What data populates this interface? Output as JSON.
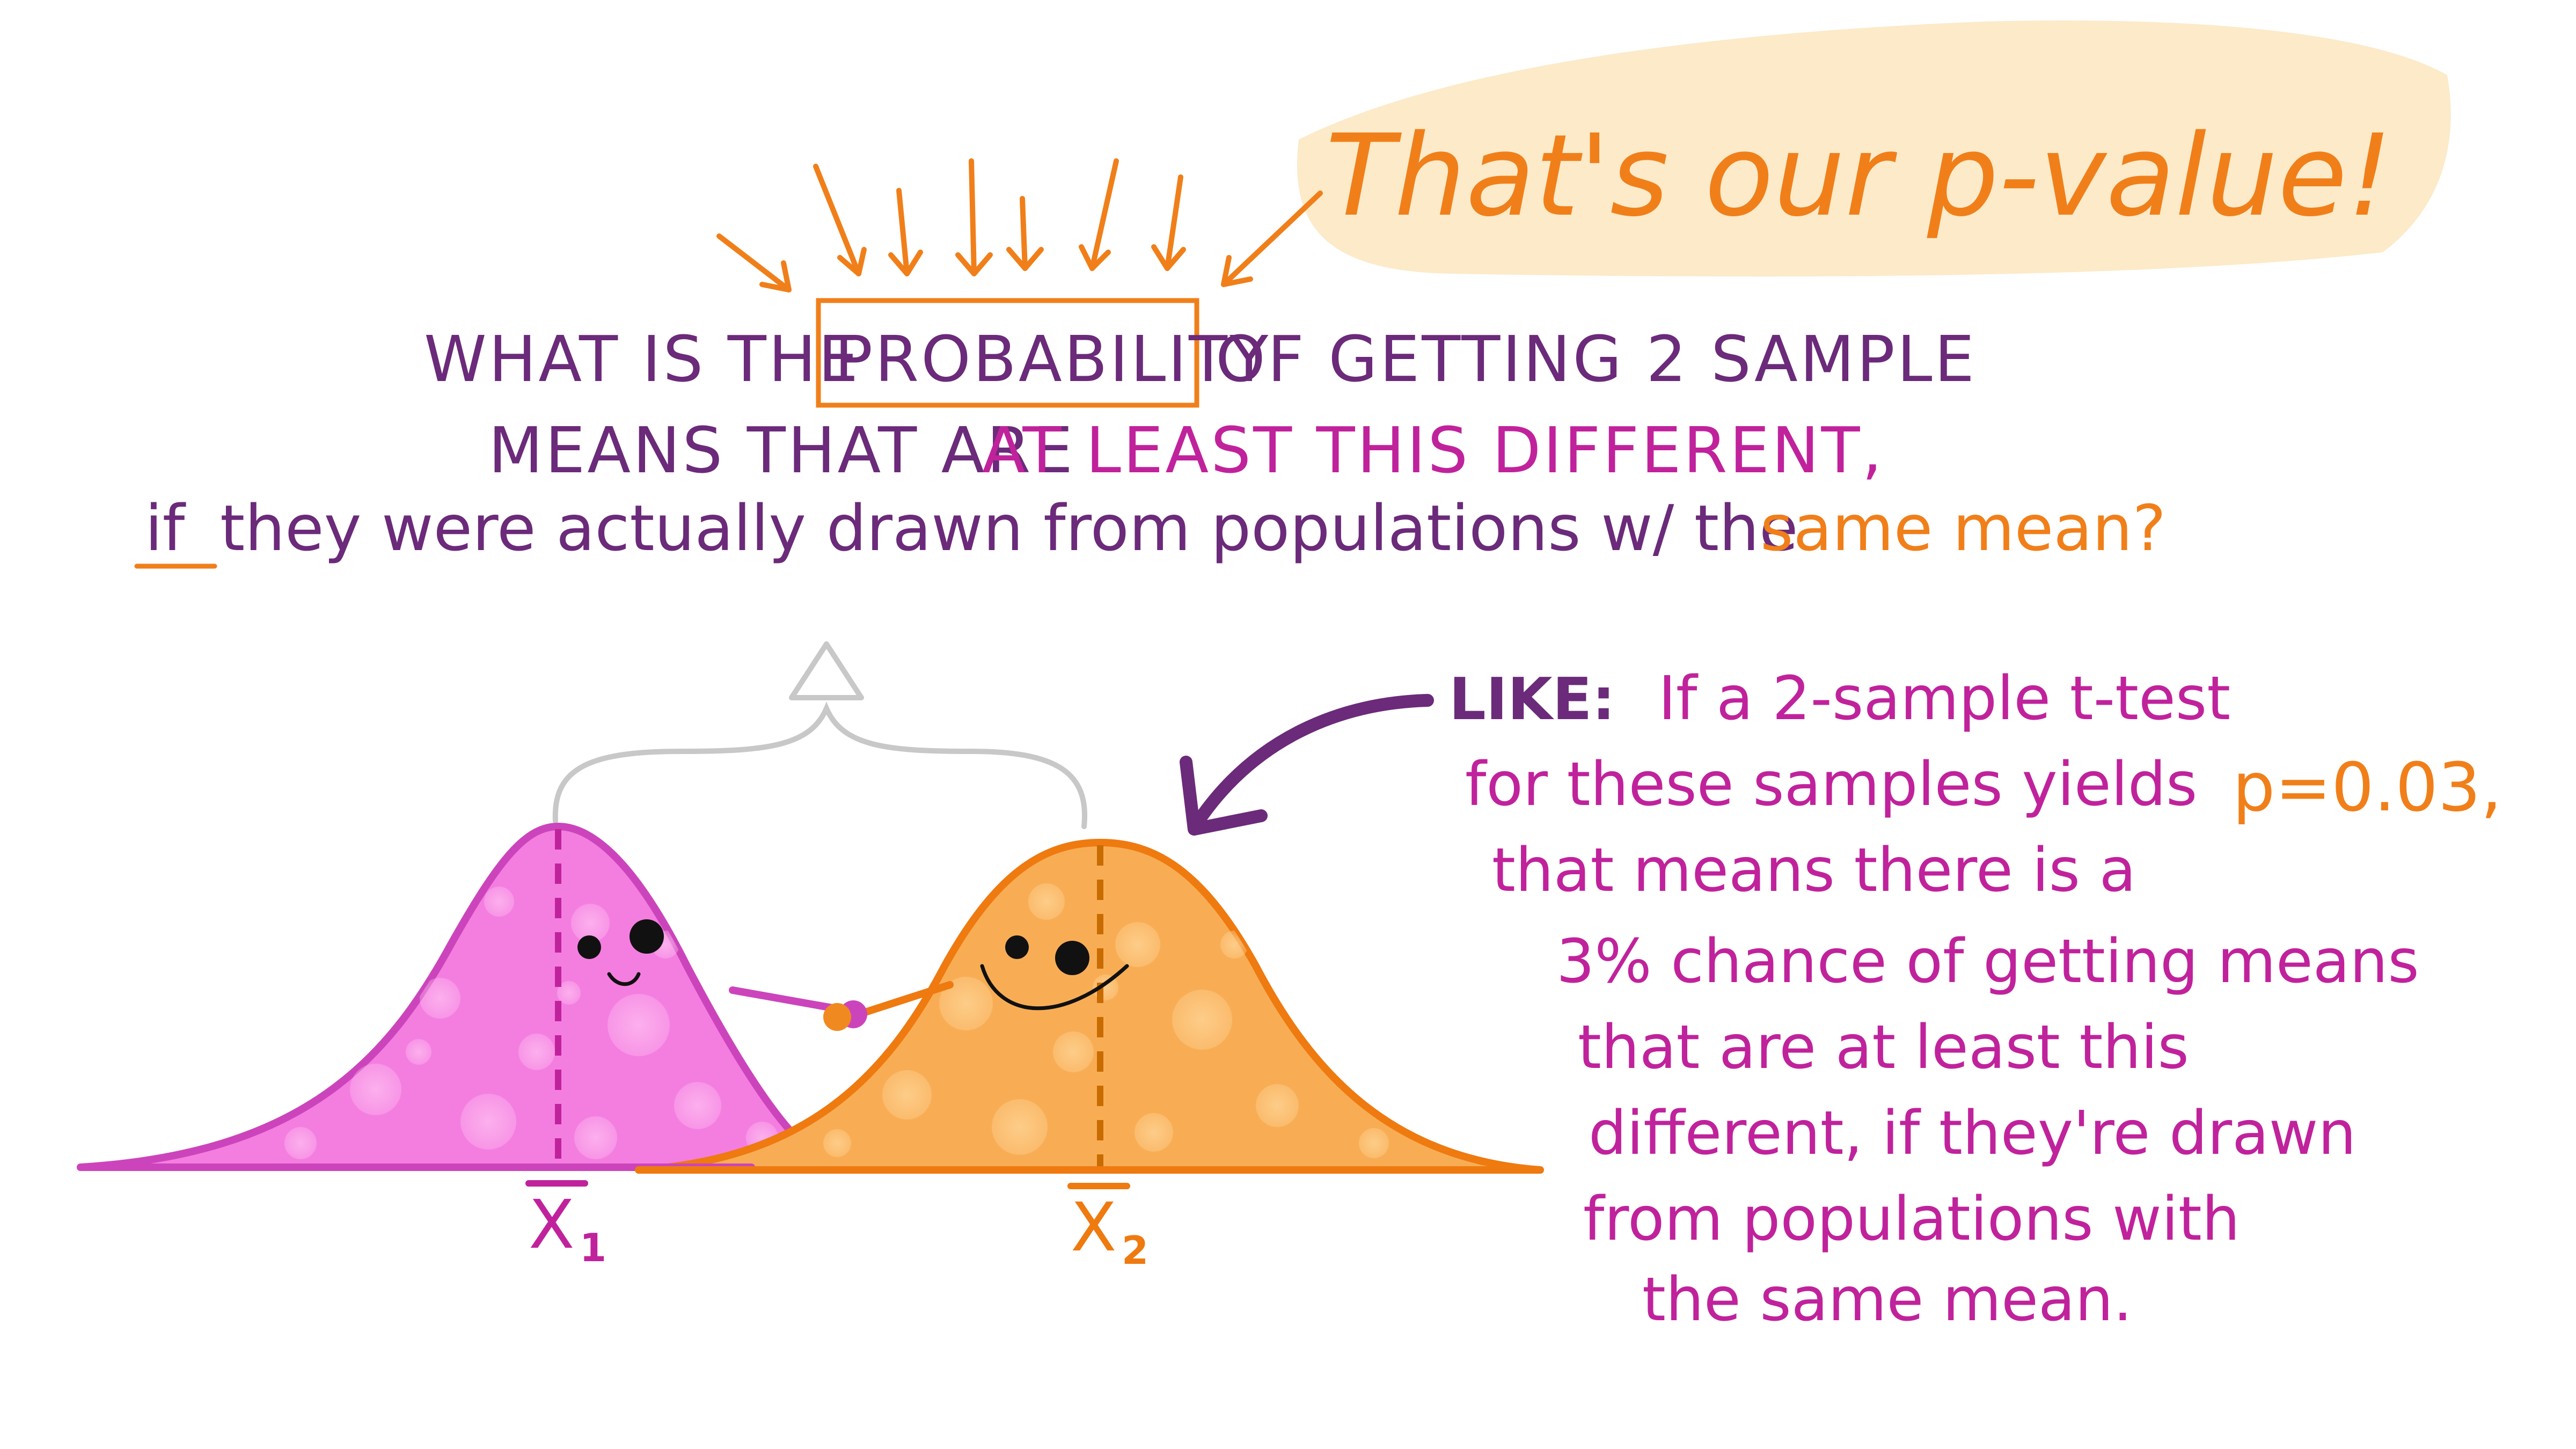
{
  "headline": "That's our p-value!",
  "question": {
    "line1_a": "WHAT IS THE",
    "line1_box": "PROBABILITY",
    "line1_b": "OF GETTING 2 SAMPLE",
    "line2_a": "MEANS THAT ARE",
    "line2_b": "AT LEAST THIS DIFFERENT,",
    "line3_if": "if",
    "line3_mid": "they were actually drawn from populations w/ the",
    "line3_end": "same mean?"
  },
  "example": {
    "label": "LIKE:",
    "line1": "If a  2-sample t-test",
    "line2": "for these samples yields",
    "pvalue": "p=0.03,",
    "line3": "that means there  is a",
    "line4": "3% chance of getting means",
    "line5": "that are at least this",
    "line6": "different, if they're drawn",
    "line7": "from populations with",
    "line8": "the same mean."
  },
  "curves": [
    {
      "name": "sample-1",
      "mean_label": "X",
      "subscript": "1",
      "color": "#cc44bb",
      "fill": "#f47ee0"
    },
    {
      "name": "sample-2",
      "mean_label": "X",
      "subscript": "2",
      "color": "#ee7a10",
      "fill": "#f8ad55"
    }
  ],
  "colors": {
    "purple": "#6b2a7a",
    "magenta": "#c0229c",
    "orange": "#f07f1a",
    "highlight": "#fbe6c0",
    "gray": "#c8c8c8"
  },
  "icons": [
    "arrow-down-icon",
    "delta-triangle-icon",
    "curved-arrow-icon"
  ]
}
